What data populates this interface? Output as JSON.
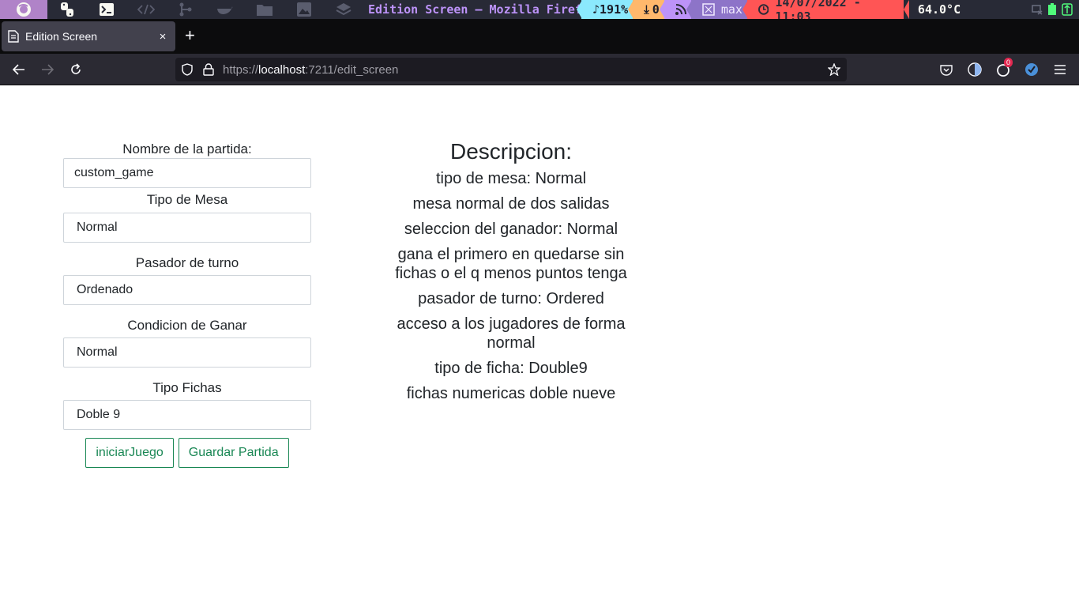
{
  "system_bar": {
    "window_title": "Edition Screen — Mozilla Firef",
    "volume": "191%",
    "downloads": "0",
    "layout": "max",
    "datetime": "14/07/2022 - 11:03",
    "temperature": "64.0°C",
    "workspace_icons": [
      "firefox-icon",
      "python-icon",
      "terminal-icon",
      "code-icon",
      "git-icon",
      "docker-icon",
      "folder-icon",
      "image-icon",
      "layers-icon"
    ]
  },
  "browser": {
    "tab_title": "Edition Screen",
    "tab_close": "×",
    "new_tab": "+",
    "url_scheme": "https://",
    "url_host": "localhost",
    "url_rest": ":7211/edit_screen",
    "extension_badge": "0"
  },
  "form": {
    "fields": [
      {
        "label": "Nombre de la partida:",
        "value": "custom_game"
      },
      {
        "label": "Tipo de Mesa",
        "value": "Normal"
      },
      {
        "label": "Pasador de turno",
        "value": "Ordenado"
      },
      {
        "label": "Condicion de Ganar",
        "value": "Normal"
      },
      {
        "label": "Tipo Fichas",
        "value": "Doble 9"
      }
    ],
    "start_button": "iniciarJuego",
    "save_button": "Guardar Partida"
  },
  "description": {
    "title": "Descripcion:",
    "lines": [
      "tipo de mesa: Normal",
      "mesa normal de dos salidas",
      "seleccion del ganador: Normal",
      "gana el primero en quedarse sin fichas o el q menos puntos tenga",
      "pasador de turno: Ordered",
      "acceso a los jugadores de forma normal",
      "tipo de ficha: Double9",
      "fichas numericas doble nueve"
    ]
  },
  "colors": {
    "accent_green": "#198754",
    "input_border": "#ced4da",
    "text": "#212529"
  }
}
